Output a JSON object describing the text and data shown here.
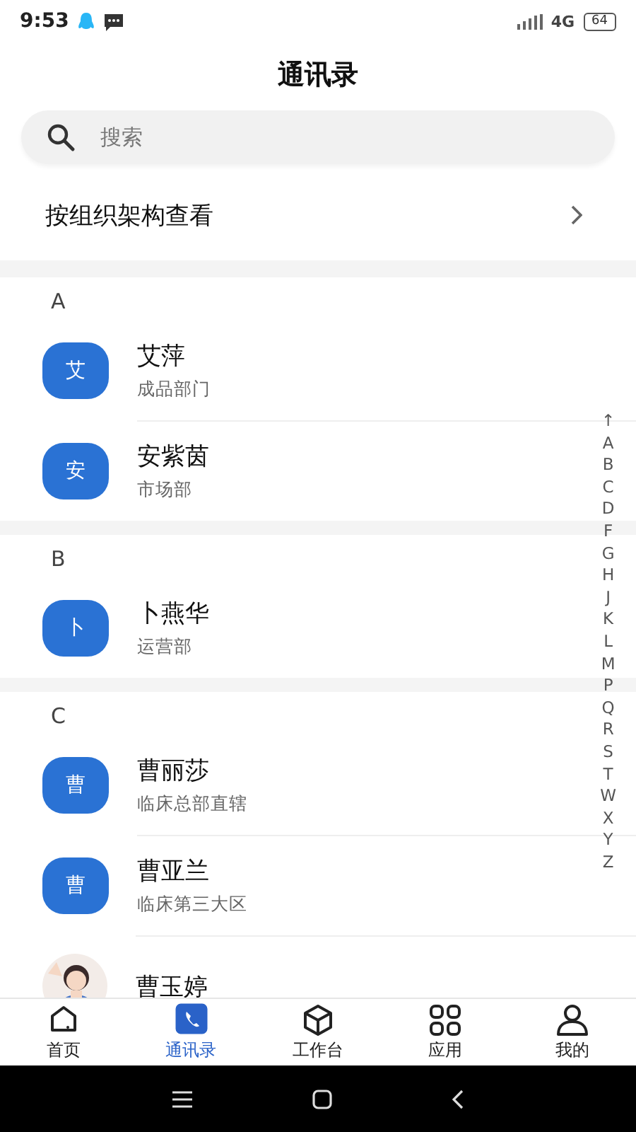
{
  "status_bar": {
    "time": "9:53",
    "network": "4G",
    "battery": "64"
  },
  "header": {
    "title": "通讯录"
  },
  "search": {
    "placeholder": "搜索"
  },
  "org_link": {
    "label": "按组织架构查看"
  },
  "sections": [
    {
      "letter": "A",
      "contacts": [
        {
          "kind": "letter",
          "avatar": "艾",
          "name": "艾萍",
          "department": "成品部门"
        },
        {
          "kind": "letter",
          "avatar": "安",
          "name": "安紫茵",
          "department": "市场部"
        }
      ]
    },
    {
      "letter": "B",
      "contacts": [
        {
          "kind": "letter",
          "avatar": "卜",
          "name": "卜燕华",
          "department": "运营部"
        }
      ]
    },
    {
      "letter": "C",
      "contacts": [
        {
          "kind": "letter",
          "avatar": "曹",
          "name": "曹丽莎",
          "department": "临床总部直辖"
        },
        {
          "kind": "letter",
          "avatar": "曹",
          "name": "曹亚兰",
          "department": "临床第三大区"
        },
        {
          "kind": "picture",
          "name": "曹玉婷"
        }
      ]
    }
  ],
  "index_bar": [
    "↑",
    "A",
    "B",
    "C",
    "D",
    "F",
    "G",
    "H",
    "J",
    "K",
    "L",
    "M",
    "P",
    "Q",
    "R",
    "S",
    "T",
    "W",
    "X",
    "Y",
    "Z"
  ],
  "tab_bar": [
    {
      "label": "首页",
      "selected": false
    },
    {
      "label": "通讯录",
      "selected": true
    },
    {
      "label": "工作台",
      "selected": false
    },
    {
      "label": "应用",
      "selected": false
    },
    {
      "label": "我的",
      "selected": false
    }
  ]
}
